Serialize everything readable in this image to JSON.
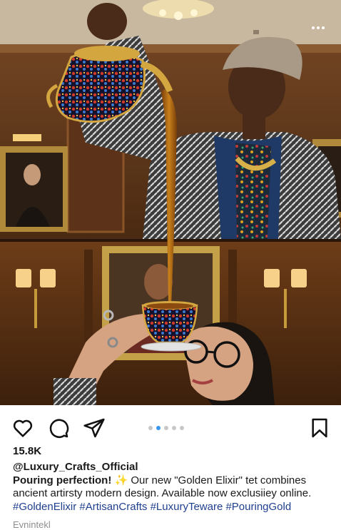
{
  "post": {
    "username": "@Luxury_Crafts_Official",
    "likes": "15.8K",
    "caption_lead": "Pouring perfection!",
    "caption_emoji": "✨",
    "caption_body": " Our new \"Golden Elixir\" tet combines ancient artirsty modern design. Available now exclusiiey online.",
    "hashtags": "#GoldenElixir #ArtisanCrafts #LuxuryTeware #PouringGold",
    "comments_hint": "Evnintekl"
  },
  "icons": {
    "more": "more-horizontal-icon",
    "like": "heart-icon",
    "comment": "comment-bubble-icon",
    "share": "paper-plane-icon",
    "save": "bookmark-icon"
  },
  "carousel": {
    "total": 5,
    "active": 2
  },
  "colors": {
    "hashtag": "#1f3f8f",
    "carousel_active": "#3897f0",
    "carousel_inactive": "#c7c7c7",
    "tea": "#a8620f",
    "wood": "#5a3318"
  }
}
